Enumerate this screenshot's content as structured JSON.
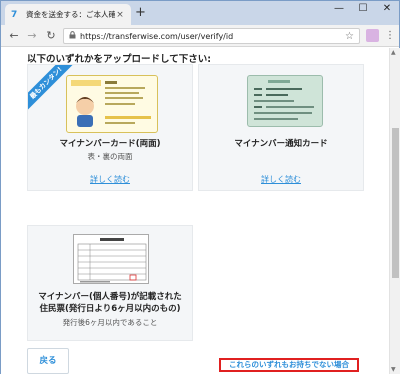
{
  "browser": {
    "tab_title": "資金を送金する：ご本人確認",
    "tab_close": "×",
    "new_tab": "+",
    "url": "https://transferwise.com/user/verify/id",
    "window_controls": {
      "minimize": "—",
      "maximize": "☐",
      "close": "✕"
    },
    "nav": {
      "back": "←",
      "forward": "→",
      "reload": "↻",
      "star": "☆",
      "menu": "⋮",
      "lock": "🔒"
    },
    "favicon": "7"
  },
  "page": {
    "heading": "以下のいずれかをアップロードして下さい:",
    "cards": [
      {
        "title": "マイナンバーカード(両面)",
        "subtitle": "表・裏の両面",
        "link": "詳しく読む",
        "ribbon": "最もカンタン!"
      },
      {
        "title": "マイナンバー通知カード",
        "subtitle": "",
        "link": "詳しく読む"
      },
      {
        "title_line1": "マイナンバー(個人番号)が記載された",
        "title_line2": "住民票(発行日より6ヶ月以内のもの)",
        "subtitle": "発行後6ヶ月以内であること"
      }
    ],
    "back_button": "戻る",
    "none_link": "これらのいずれもお持ちでない場合"
  },
  "colors": {
    "accent": "#2e8fd9",
    "highlight_box": "#e02020",
    "card_bg": "#f4f6f8"
  }
}
